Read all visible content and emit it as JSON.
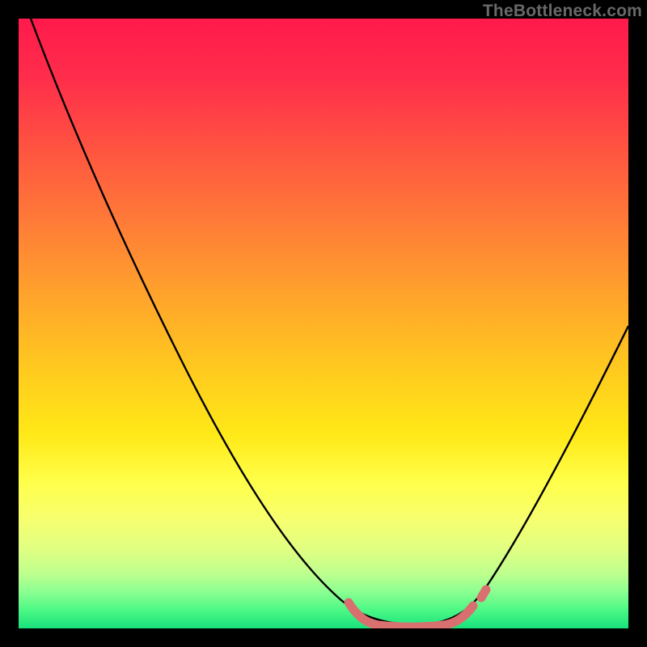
{
  "watermark": "TheBottleneck.com",
  "chart_data": {
    "type": "line",
    "title": "",
    "xlabel": "",
    "ylabel": "",
    "xlim": [
      0,
      100
    ],
    "ylim": [
      0,
      100
    ],
    "series": [
      {
        "name": "bottleneck-curve",
        "color": "#000000",
        "x": [
          2,
          8,
          14,
          20,
          26,
          32,
          38,
          44,
          50,
          54,
          58,
          62,
          66,
          70,
          74,
          78,
          82,
          86,
          90,
          94,
          98,
          100
        ],
        "y": [
          100,
          89,
          78,
          67,
          56,
          46,
          36,
          26,
          16,
          10,
          5,
          2,
          1,
          1,
          2,
          6,
          13,
          22,
          32,
          43,
          54,
          60
        ]
      },
      {
        "name": "optimal-range-marker",
        "color": "#d96f6f",
        "x": [
          56,
          58,
          60,
          62,
          64,
          66,
          68,
          70,
          72,
          74,
          76
        ],
        "y": [
          3.5,
          2.0,
          1.2,
          0.8,
          0.6,
          0.6,
          0.8,
          1.0,
          1.6,
          2.5,
          4.2
        ]
      }
    ],
    "gradient_stops": [
      {
        "pos": 0,
        "color": "#ff1a4b"
      },
      {
        "pos": 22,
        "color": "#ff5640"
      },
      {
        "pos": 45,
        "color": "#ffa22c"
      },
      {
        "pos": 68,
        "color": "#ffe817"
      },
      {
        "pos": 87,
        "color": "#e0ff82"
      },
      {
        "pos": 100,
        "color": "#18e27c"
      }
    ]
  }
}
